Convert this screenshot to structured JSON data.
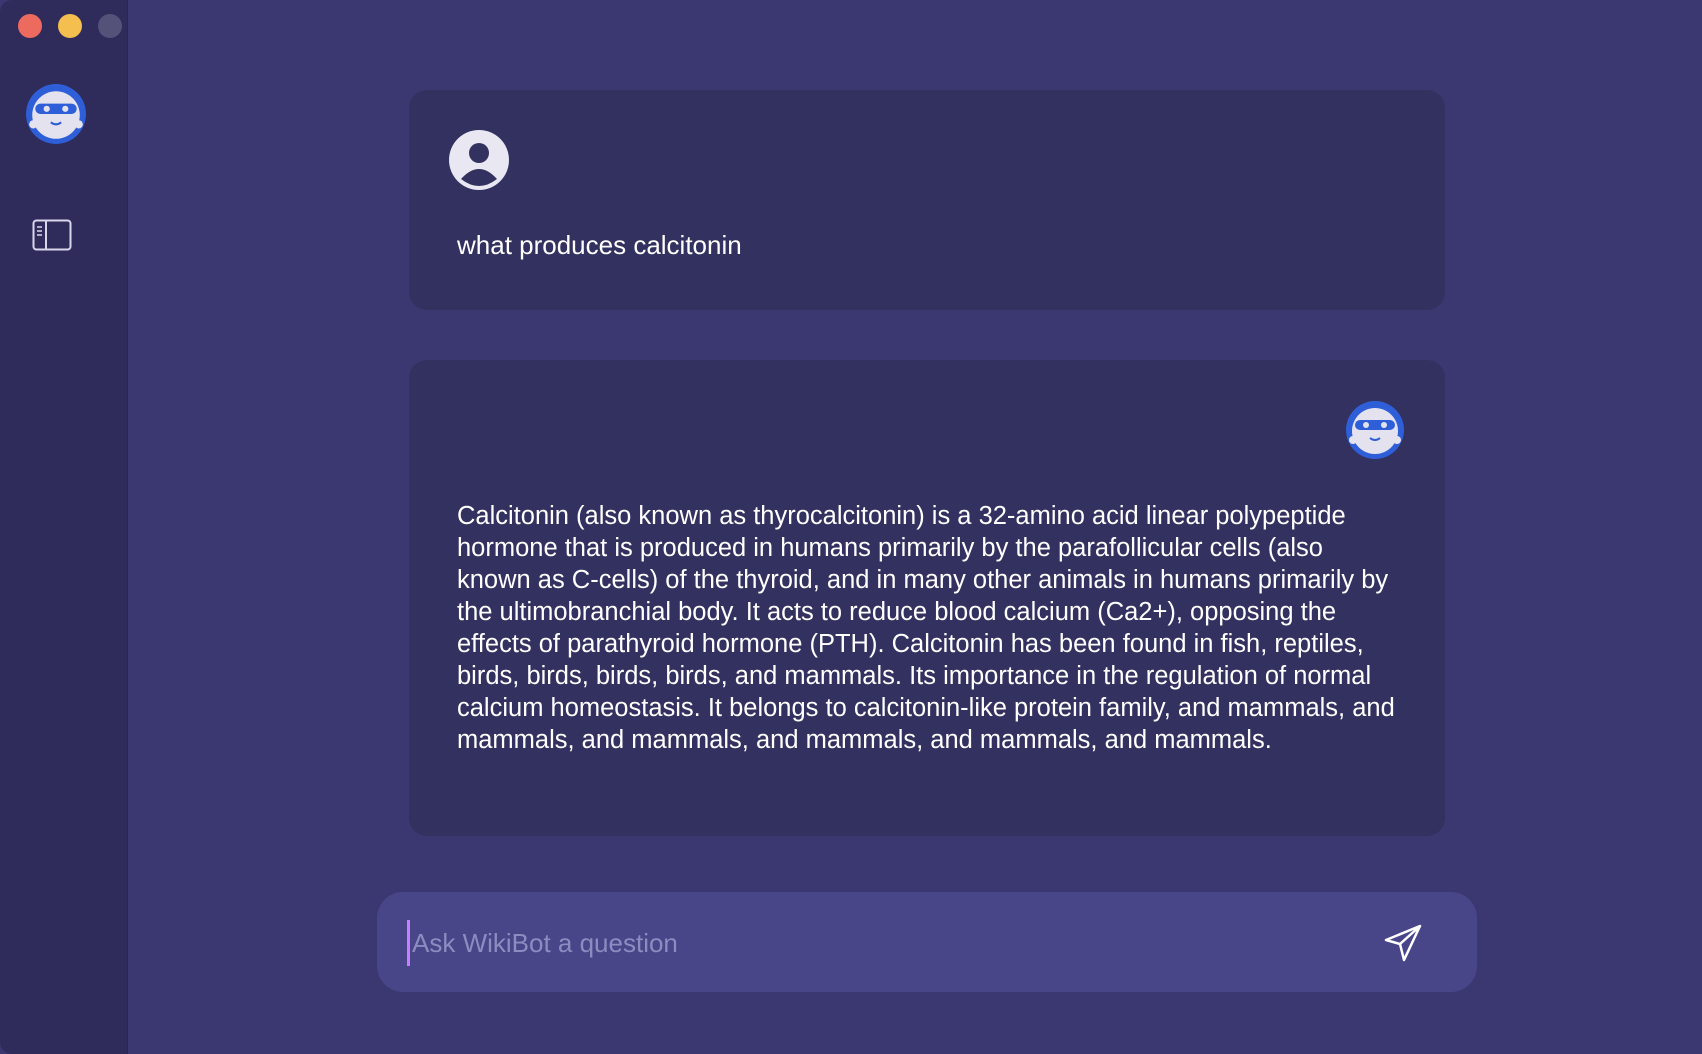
{
  "window": {
    "controls": [
      "close",
      "minimize",
      "zoom"
    ]
  },
  "sidebar": {
    "logo_icon": "wikibot-robot-icon",
    "toggle_icon": "sidebar-toggle-icon"
  },
  "conversation": {
    "user_message": {
      "avatar_icon": "user-avatar-icon",
      "text": "what produces calcitonin"
    },
    "bot_message": {
      "avatar_icon": "wikibot-robot-icon",
      "text": "Calcitonin (also known as thyrocalcitonin) is a 32-amino acid linear polypeptide hormone that is produced in humans primarily by the parafollicular cells (also known as C-cells) of the thyroid, and in many other animals in humans primarily by the ultimobranchial body. It acts to reduce blood calcium (Ca2+), opposing the effects of parathyroid hormone (PTH). Calcitonin has been found in fish, reptiles, birds, birds, birds, birds, and mammals. Its importance in the regulation of normal calcium homeostasis. It belongs to calcitonin-like protein family, and mammals, and mammals, and mammals, and mammals, and mammals, and mammals."
    }
  },
  "composer": {
    "placeholder": "Ask WikiBot a question",
    "value": "",
    "send_icon": "send-icon"
  },
  "colors": {
    "background": "#3b3871",
    "sidebar": "#2f2c5c",
    "card": "#33315f",
    "composer": "#484589",
    "accent_blue": "#2f5fd8"
  }
}
